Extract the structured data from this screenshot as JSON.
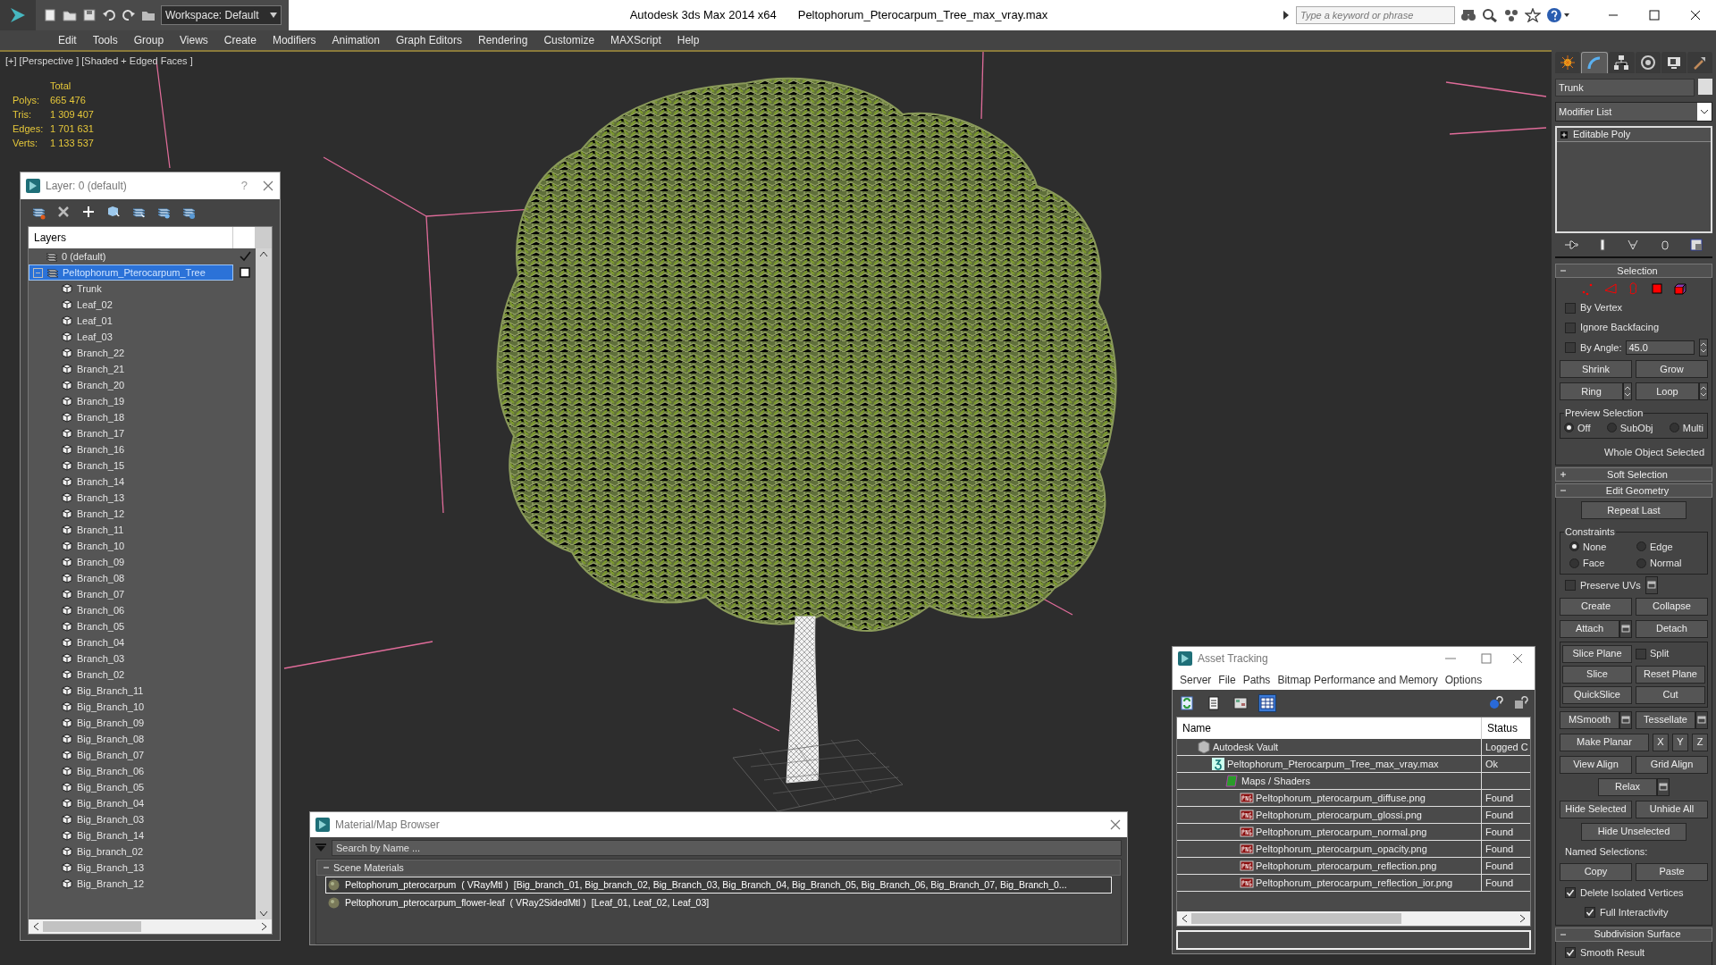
{
  "title_bar": {
    "workspace": "Workspace: Default",
    "app_title": "Autodesk 3ds Max  2014 x64",
    "file_title": "Peltophorum_Pterocarpum_Tree_max_vray.max",
    "search_placeholder": "Type a keyword or phrase"
  },
  "menu": [
    "Edit",
    "Tools",
    "Group",
    "Views",
    "Create",
    "Modifiers",
    "Animation",
    "Graph Editors",
    "Rendering",
    "Customize",
    "MAXScript",
    "Help"
  ],
  "viewport": {
    "label": "[+] [Perspective ] [Shaded + Edged Faces ]",
    "stats_heading": "Total",
    "stats": [
      {
        "label": "Polys:",
        "value": "665 476"
      },
      {
        "label": "Tris:",
        "value": "1 309 407"
      },
      {
        "label": "Edges:",
        "value": "1 701 631"
      },
      {
        "label": "Verts:",
        "value": "1 133 537"
      }
    ]
  },
  "layer_window": {
    "title": "Layer: 0 (default)",
    "help": "?",
    "list_heading": "Layers",
    "layers": [
      {
        "name": "0 (default)",
        "selected": false,
        "current": true
      },
      {
        "name": "Peltophorum_Pterocarpum_Tree",
        "selected": true,
        "current": false,
        "expanded": true,
        "children": [
          "Trunk",
          "Leaf_02",
          "Leaf_01",
          "Leaf_03",
          "Branch_22",
          "Branch_21",
          "Branch_20",
          "Branch_19",
          "Branch_18",
          "Branch_17",
          "Branch_16",
          "Branch_15",
          "Branch_14",
          "Branch_13",
          "Branch_12",
          "Branch_11",
          "Branch_10",
          "Branch_09",
          "Branch_08",
          "Branch_07",
          "Branch_06",
          "Branch_05",
          "Branch_04",
          "Branch_03",
          "Branch_02",
          "Big_Branch_11",
          "Big_Branch_10",
          "Big_Branch_09",
          "Big_Branch_08",
          "Big_Branch_07",
          "Big_Branch_06",
          "Big_Branch_05",
          "Big_Branch_04",
          "Big_Branch_03",
          "Big_Branch_14",
          "Big_branch_02",
          "Big_Branch_13",
          "Big_Branch_12"
        ]
      }
    ]
  },
  "material_browser": {
    "title": "Material/Map Browser",
    "search_placeholder": "Search by Name ...",
    "group": "Scene Materials",
    "group_expanded": true,
    "materials": [
      {
        "name": "Peltophorum_pterocarpum",
        "type": "( VRayMtl )",
        "objects": "[Big_branch_01, Big_branch_02, Big_Branch_03, Big_Branch_04, Big_Branch_05, Big_Branch_06, Big_Branch_07, Big_Branch_0...",
        "selected": true
      },
      {
        "name": "Peltophorum_pterocarpum_flower-leaf",
        "type": "( VRay2SidedMtl )",
        "objects": "[Leaf_01, Leaf_02, Leaf_03]",
        "selected": false
      }
    ]
  },
  "asset_tracking": {
    "title": "Asset Tracking",
    "menu": [
      "Server",
      "File",
      "Paths",
      "Bitmap Performance and Memory",
      "Options"
    ],
    "toolbar": [
      {
        "kind": "refresh",
        "selected": false
      },
      {
        "kind": "list",
        "selected": false
      },
      {
        "kind": "thumbnails",
        "selected": false
      },
      {
        "kind": "table",
        "selected": true
      }
    ],
    "columns": [
      "Name",
      "Status"
    ],
    "rows": [
      {
        "kind": "vault",
        "name": "Autodesk Vault",
        "status": "Logged C",
        "children": [
          {
            "kind": "scene",
            "name": "Peltophorum_Pterocarpum_Tree_max_vray.max",
            "status": "Ok",
            "children": [
              {
                "kind": "folder",
                "name": "Maps / Shaders",
                "children": [
                  {
                    "kind": "png",
                    "name": "Peltophorum_pterocarpum_diffuse.png",
                    "status": "Found"
                  },
                  {
                    "kind": "png",
                    "name": "Peltophorum_pterocarpum_glossi.png",
                    "status": "Found"
                  },
                  {
                    "kind": "png",
                    "name": "Peltophorum_pterocarpum_normal.png",
                    "status": "Found"
                  },
                  {
                    "kind": "png",
                    "name": "Peltophorum_pterocarpum_opacity.png",
                    "status": "Found"
                  },
                  {
                    "kind": "png",
                    "name": "Peltophorum_pterocarpum_reflection.png",
                    "status": "Found"
                  },
                  {
                    "kind": "png",
                    "name": "Peltophorum_pterocarpum_reflection_ior.png",
                    "status": "Found"
                  }
                ]
              }
            ]
          }
        ]
      }
    ]
  },
  "command_panel": {
    "tabs": [
      {
        "kind": "create",
        "selected": false
      },
      {
        "kind": "modify",
        "selected": true
      },
      {
        "kind": "hierarchy",
        "selected": false
      },
      {
        "kind": "motion",
        "selected": false
      },
      {
        "kind": "display",
        "selected": false
      },
      {
        "kind": "utilities",
        "selected": false
      }
    ],
    "object_name": "Trunk",
    "modifier_list": "Modifier List",
    "stack": [
      "Editable Poly"
    ],
    "rollouts": [
      {
        "title": "Selection",
        "expanded": true,
        "rows": [
          {
            "kind": "subobject_icons"
          },
          {
            "kind": "checkbox",
            "label": "By Vertex",
            "checked": false
          },
          {
            "kind": "checkbox",
            "label": "Ignore Backfacing",
            "checked": false
          },
          {
            "kind": "spinner",
            "label": "By Angle:",
            "checked": false,
            "value": "45.0"
          },
          {
            "kind": "buttons",
            "items": [
              {
                "label": "Shrink"
              },
              {
                "label": "Grow"
              }
            ]
          },
          {
            "kind": "buttons",
            "items": [
              {
                "label": "Ring",
                "spinner": true
              },
              {
                "label": "Loop",
                "spinner": true
              }
            ]
          },
          {
            "kind": "radio_group",
            "title": "Preview Selection",
            "options": [
              {
                "label": "Off",
                "selected": true
              },
              {
                "label": "SubObj",
                "selected": false
              },
              {
                "label": "Multi",
                "selected": false
              }
            ]
          },
          {
            "kind": "text",
            "text": "Whole Object Selected"
          }
        ]
      },
      {
        "title": "Soft Selection",
        "expanded": false
      },
      {
        "title": "Edit Geometry",
        "expanded": true,
        "rows": [
          {
            "kind": "buttons",
            "items": [
              {
                "label": "Repeat Last"
              }
            ]
          },
          {
            "kind": "radio_group",
            "title": "Constraints",
            "options": [
              {
                "label": "None",
                "selected": true
              },
              {
                "label": "Edge",
                "selected": false
              },
              {
                "label": "Face",
                "selected": false
              },
              {
                "label": "Normal",
                "selected": false
              }
            ]
          },
          {
            "kind": "checkbox",
            "label": "Preserve UVs",
            "checked": false,
            "settings": true
          },
          {
            "kind": "buttons",
            "items": [
              {
                "label": "Create"
              },
              {
                "label": "Collapse"
              }
            ]
          },
          {
            "kind": "buttons",
            "items": [
              {
                "label": "Attach",
                "settings": true
              },
              {
                "label": "Detach"
              }
            ]
          },
          {
            "kind": "group",
            "rows": [
              {
                "kind": "buttons",
                "items": [
                  {
                    "label": "Slice Plane"
                  },
                  {
                    "kind": "checkbox",
                    "label": "Split",
                    "checked": false
                  }
                ]
              },
              {
                "kind": "buttons",
                "items": [
                  {
                    "label": "Slice"
                  },
                  {
                    "label": "Reset Plane"
                  }
                ]
              },
              {
                "kind": "buttons",
                "items": [
                  {
                    "label": "QuickSlice"
                  },
                  {
                    "label": "Cut"
                  }
                ]
              }
            ]
          },
          {
            "kind": "buttons",
            "items": [
              {
                "label": "MSmooth",
                "settings": true
              },
              {
                "label": "Tessellate",
                "settings": true
              }
            ]
          },
          {
            "kind": "buttons",
            "items": [
              {
                "label": "Make Planar"
              },
              {
                "label": "X",
                "small": true
              },
              {
                "label": "Y",
                "small": true
              },
              {
                "label": "Z",
                "small": true
              }
            ]
          },
          {
            "kind": "buttons",
            "items": [
              {
                "label": "View Align"
              },
              {
                "label": "Grid Align"
              }
            ]
          },
          {
            "kind": "buttons",
            "items": [
              {
                "label": "Relax",
                "settings": true
              }
            ]
          },
          {
            "kind": "buttons",
            "items": [
              {
                "label": "Hide Selected"
              },
              {
                "label": "Unhide All"
              }
            ]
          },
          {
            "kind": "buttons",
            "items": [
              {
                "label": "Hide Unselected"
              }
            ]
          },
          {
            "kind": "text",
            "text": "Named Selections:"
          },
          {
            "kind": "buttons",
            "items": [
              {
                "label": "Copy"
              },
              {
                "label": "Paste"
              }
            ]
          },
          {
            "kind": "checkbox",
            "label": "Delete Isolated Vertices",
            "checked": true
          },
          {
            "kind": "checkbox",
            "label": "Full Interactivity",
            "checked": true,
            "centered": true
          }
        ]
      },
      {
        "title": "Subdivision Surface",
        "expanded": true,
        "rows": [
          {
            "kind": "checkbox",
            "label": "Smooth Result",
            "checked": true
          }
        ]
      }
    ]
  }
}
